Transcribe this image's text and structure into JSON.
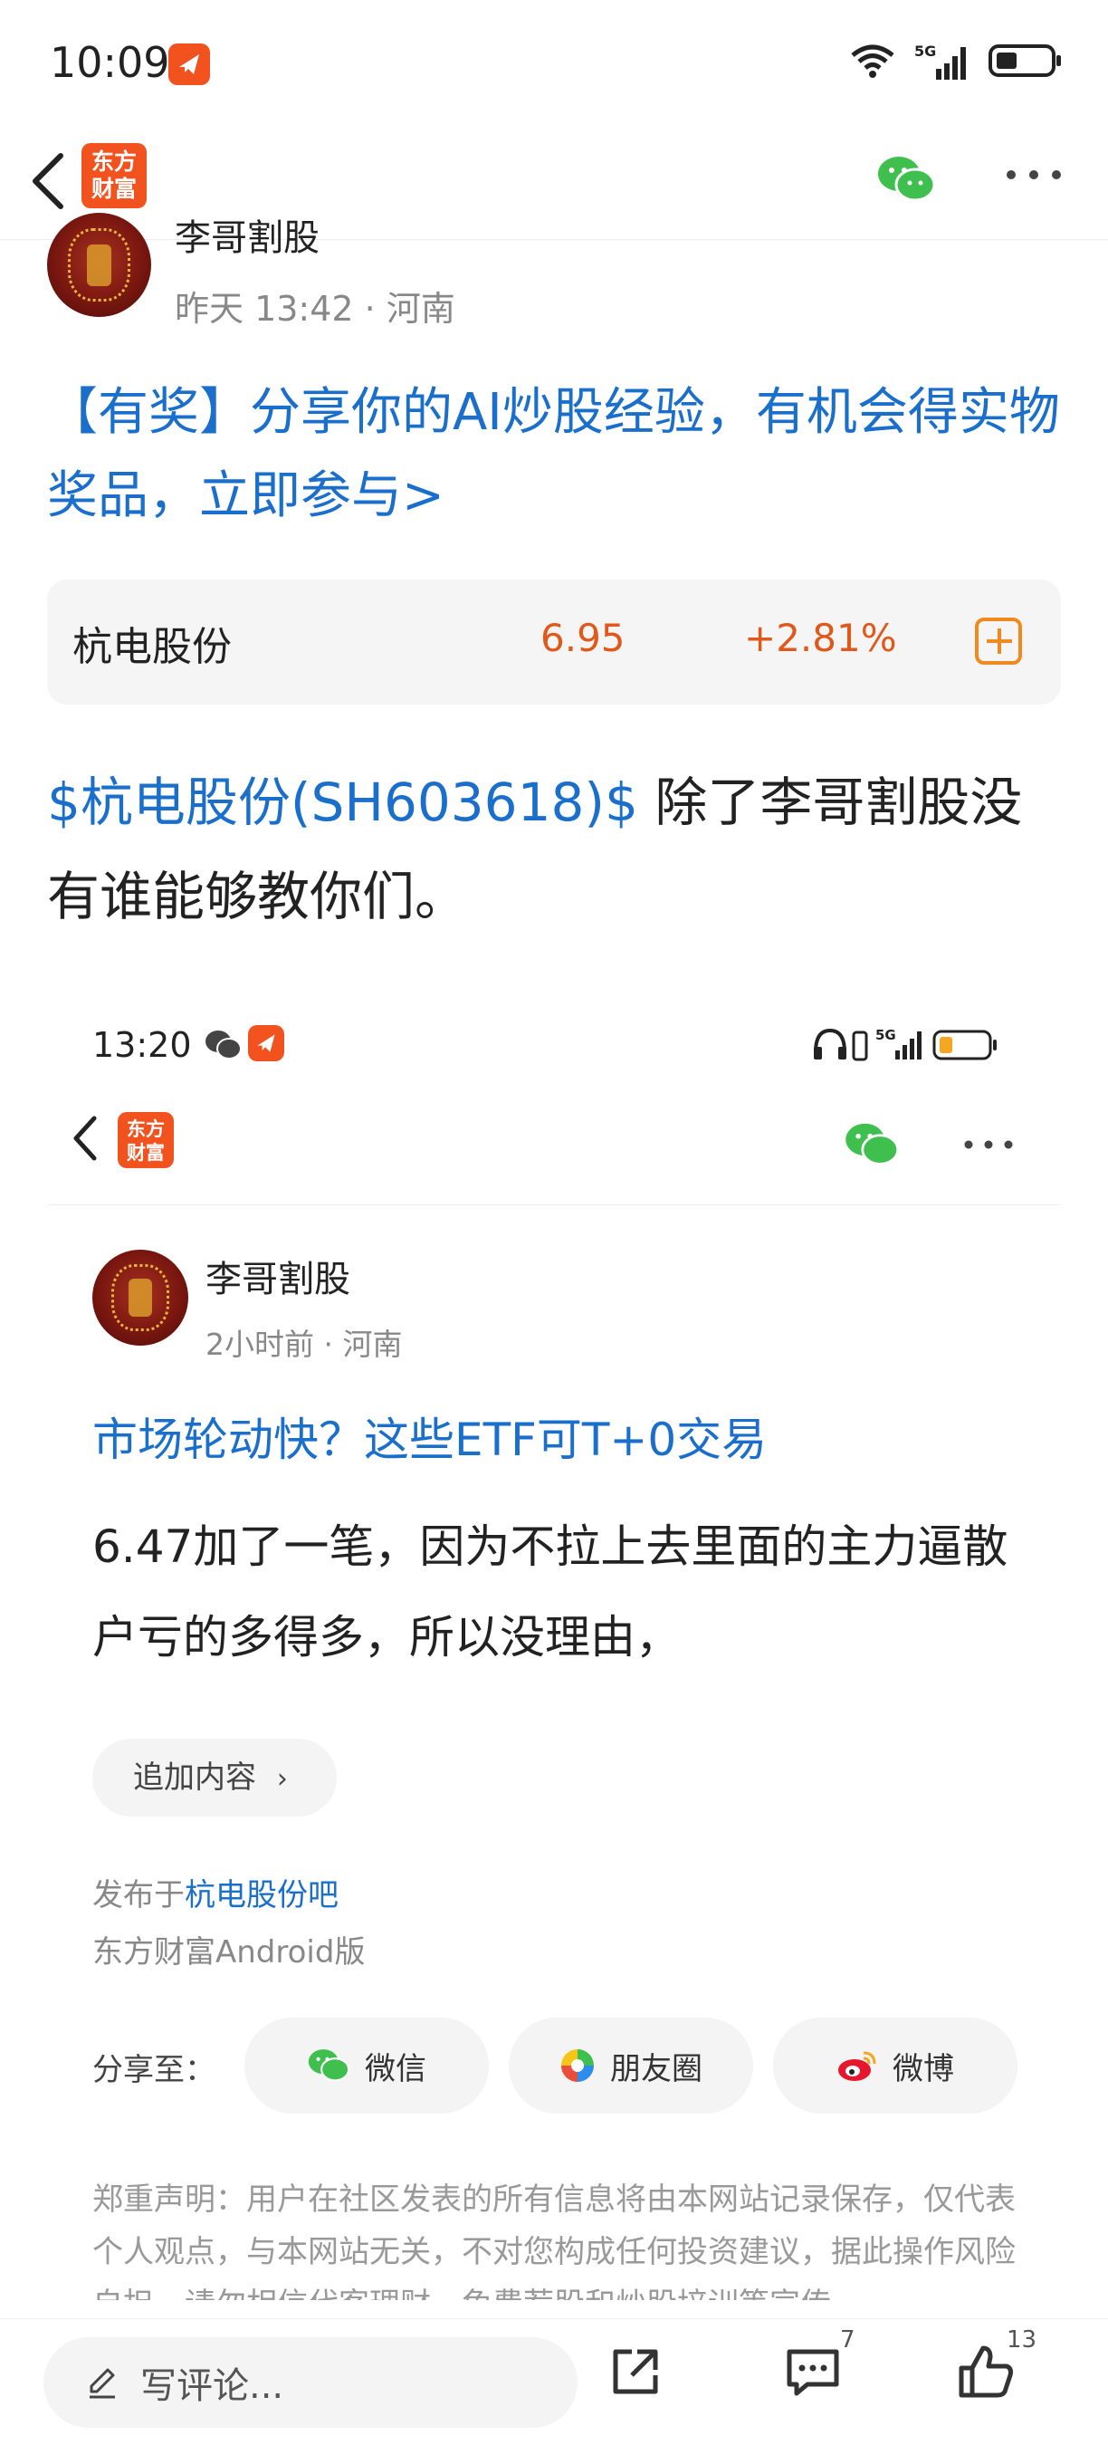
{
  "status_bar": {
    "time": "10:09",
    "network": "5G"
  },
  "header": {
    "logo_line1": "东方",
    "logo_line2": "财富"
  },
  "post": {
    "author": "李哥割股",
    "meta": "昨天 13:42 · 河南",
    "promo": "【有奖】分享你的AI炒股经验，有机会得实物奖品，立即参与>",
    "stock": {
      "name": "杭电股份",
      "price": "6.95",
      "change": "+2.81%"
    },
    "tag": "$杭电股份(SH603618)$",
    "text": " 除了李哥割股没有谁能够教你们。"
  },
  "embedded": {
    "time": "13:20",
    "author": "李哥割股",
    "meta": "2小时前 · 河南",
    "link": "市场轮动快？这些ETF可T+0交易",
    "text": "6.47加了一笔，因为不拉上去里面的主力逼散户亏的多得多，所以没理由，",
    "add_content": "追加内容",
    "published_prefix": "发布于",
    "published_bar": "杭电股份吧",
    "platform": "东方财富Android版",
    "share_label": "分享至：",
    "share_wechat": "微信",
    "share_moments": "朋友圈",
    "share_weibo": "微博",
    "disclaimer": "郑重声明：用户在社区发表的所有信息将由本网站记录保存，仅代表个人观点，与本网站无关，不对您构成任何投资建议，据此操作风险自担。请勿相信代客理财、免费荐股和炒股培训等宣传"
  },
  "bottom": {
    "comment_placeholder": "写评论...",
    "comment_count": "7",
    "like_count": "13"
  },
  "colors": {
    "link": "#1a6fcc",
    "up": "#e0581a",
    "brand": "#f2521e",
    "wechat": "#3fbf4e"
  }
}
